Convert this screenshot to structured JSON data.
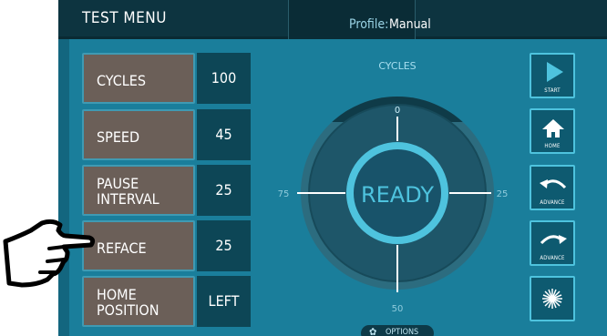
{
  "header": {
    "title": "TEST MENU",
    "profile_key": "Profile:",
    "profile_value": "Manual"
  },
  "settings": [
    {
      "label_lines": [
        "CYCLES"
      ],
      "value": "100"
    },
    {
      "label_lines": [
        "SPEED"
      ],
      "value": "45"
    },
    {
      "label_lines": [
        "PAUSE",
        "INTERVAL"
      ],
      "value": "25"
    },
    {
      "label_lines": [
        "REFACE"
      ],
      "value": "25"
    },
    {
      "label_lines": [
        "HOME",
        "POSITION"
      ],
      "value": "LEFT"
    }
  ],
  "dial": {
    "title": "CYCLES",
    "status": "READY",
    "tick_top": "0",
    "tick_right": "25",
    "tick_bottom": "50",
    "tick_left": "75"
  },
  "side_buttons": [
    {
      "caption": "START",
      "icon": "play-icon"
    },
    {
      "caption": "HOME",
      "icon": "home-icon"
    },
    {
      "caption": "ADVANCE",
      "icon": "arrow-left-curve-icon"
    },
    {
      "caption": "ADVANCE",
      "icon": "arrow-right-curve-icon"
    },
    {
      "caption": "",
      "icon": "laser-icon"
    }
  ],
  "options_label": "OPTIONS",
  "colors": {
    "panel": "#1a7e9b",
    "header": "#0d3440",
    "label_box": "#6b5f58",
    "value_box": "#0d4656",
    "accent": "#4ec3de"
  }
}
